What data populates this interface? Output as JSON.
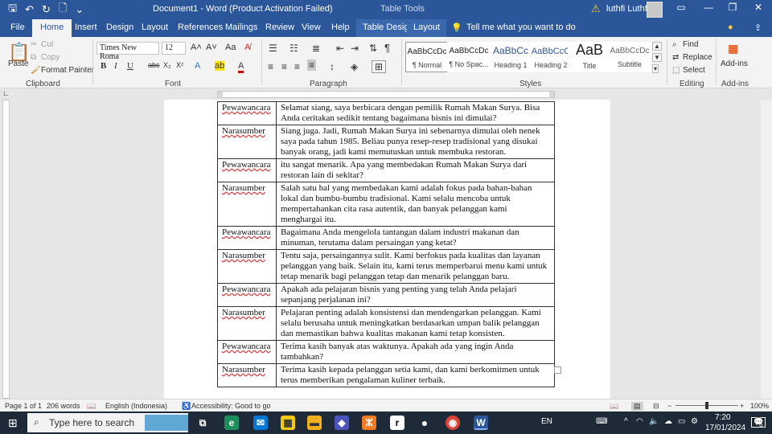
{
  "titlebar": {
    "title": "Document1 - Word (Product Activation Failed)",
    "context": "Table Tools",
    "user": "luthfi Luthfi"
  },
  "tabs": [
    "File",
    "Home",
    "Insert",
    "Design",
    "Layout",
    "References",
    "Mailings",
    "Review",
    "View",
    "Help",
    "Table Design",
    "Layout"
  ],
  "tell_me": "Tell me what you want to do",
  "ribbon": {
    "clipboard": {
      "paste": "Paste",
      "cut": "Cut",
      "copy": "Copy",
      "format_painter": "Format Painter",
      "label": "Clipboard"
    },
    "font": {
      "name": "Times New Roma",
      "size": "12",
      "label": "Font"
    },
    "paragraph": {
      "label": "Paragraph"
    },
    "styles": {
      "label": "Styles",
      "items": [
        {
          "preview": "AaBbCcDc",
          "name": "¶ Normal"
        },
        {
          "preview": "AaBbCcDc",
          "name": "¶ No Spac..."
        },
        {
          "preview": "AaBbCc",
          "name": "Heading 1"
        },
        {
          "preview": "AaBbCcC",
          "name": "Heading 2"
        },
        {
          "preview": "AaB",
          "name": "Title"
        },
        {
          "preview": "AaBbCcDc",
          "name": "Subtitle"
        }
      ]
    },
    "editing": {
      "find": "Find",
      "replace": "Replace",
      "select": "Select",
      "label": "Editing"
    },
    "addins": {
      "button": "Add-ins",
      "label": "Add-ins"
    }
  },
  "table": [
    {
      "speaker": "Pewawancara",
      "text": "Selamat siang, saya berbicara dengan pemilik Rumah Makan Surya. Bisa Anda ceritakan sedikit tentang bagaimana bisnis ini dimulai?"
    },
    {
      "speaker": "Narasumber",
      "text": "Siang juga. Jadi, Rumah Makan Surya ini sebenarnya dimulai oleh nenek saya pada tahun 1985. Beliau punya resep-resep tradisional yang disukai banyak orang, jadi kami memutuskan untuk membuka restoran."
    },
    {
      "speaker": "Pewawancara",
      "text": "itu sangat menarik. Apa yang membedakan Rumah Makan Surya dari restoran lain di sekitar?"
    },
    {
      "speaker": "Narasumber",
      "text": "Salah satu hal yang membedakan kami adalah fokus pada bahan-bahan lokal dan bumbu-bumbu tradisional. Kami selalu mencoba untuk mempertahankan cita rasa autentik, dan banyak pelanggan kami menghargai itu."
    },
    {
      "speaker": "Pewawancara",
      "text": "Bagaimana Anda mengelola tantangan dalam industri makanan dan minuman, terutama dalam persaingan yang ketat?"
    },
    {
      "speaker": "Narasumber",
      "text": "Tentu saja, persaingannya sulit. Kami berfokus pada kualitas dan layanan pelanggan yang baik. Selain itu, kami terus memperbarui menu kami untuk tetap menarik bagi pelanggan tetap dan menarik pelanggan baru."
    },
    {
      "speaker": "Pewawancara",
      "text": "Apakah ada pelajaran bisnis yang penting yang telah Anda pelajari sepanjang perjalanan ini?"
    },
    {
      "speaker": "Narasumber",
      "text": "Pelajaran penting adalah konsistensi dan mendengarkan pelanggan. Kami selalu berusaha untuk meningkatkan berdasarkan umpan balik pelanggan dan memastikan bahwa kualitas makanan kami tetap konsisten."
    },
    {
      "speaker": "Pewawancara",
      "text": "Terima kasih banyak atas waktunya. Apakah ada yang ingin Anda tambahkan?"
    },
    {
      "speaker": "Narasumber",
      "text": "Terima kasih kepada pelanggan setia kami, dan kami berkomitmen untuk terus memberikan pengalaman kuliner terbaik."
    }
  ],
  "status": {
    "page": "Page 1 of 1",
    "words": "206 words",
    "language": "English (Indonesia)",
    "accessibility": "Accessibility: Good to go",
    "zoom": "100%"
  },
  "taskbar": {
    "search": "Type here to search",
    "lang": "EN",
    "time": "7:20",
    "date": "17/01/2024",
    "notifications": "6"
  }
}
